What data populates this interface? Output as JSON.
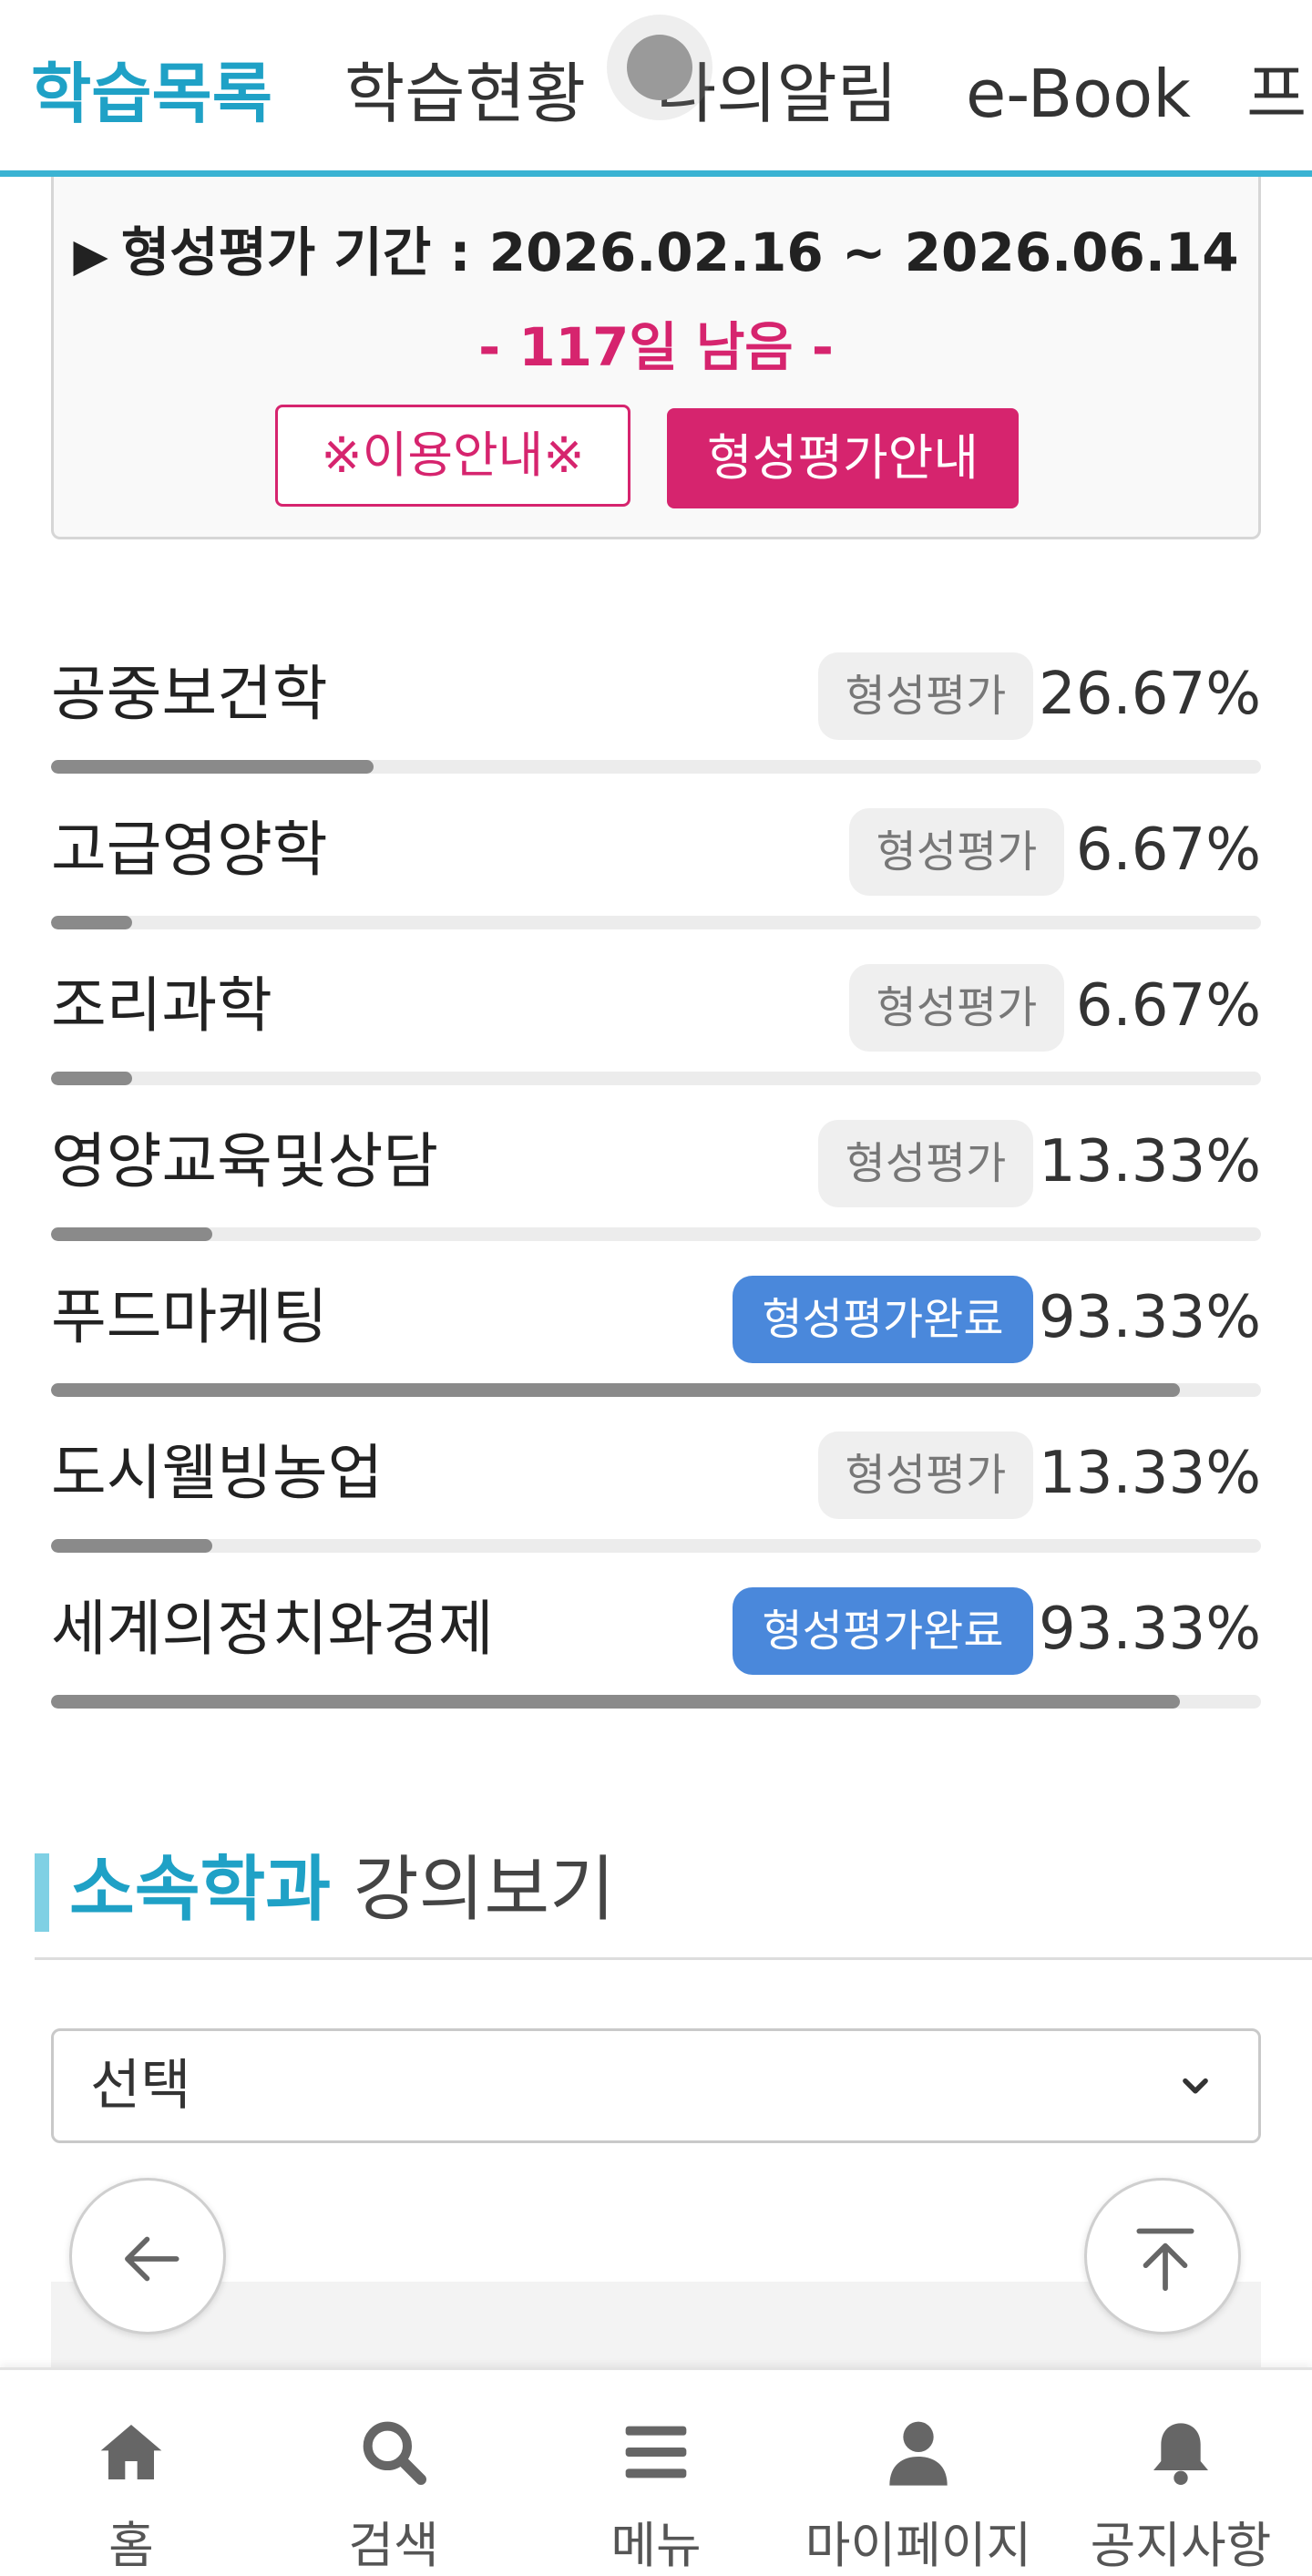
{
  "top_tabs": [
    {
      "label": "학습목록",
      "active": true
    },
    {
      "label": "학습현황",
      "active": false
    },
    {
      "label": "나의알림",
      "active": false
    },
    {
      "label": "e-Book",
      "active": false
    },
    {
      "label": "프",
      "active": false
    }
  ],
  "evaluation": {
    "period_label": "형성평가 기간 : 2026.02.16 ~ 2026.06.14",
    "remaining": "- 117일 남음 -",
    "usage_guide_button": "※이용안내※",
    "evaluation_guide_button": "형성평가안내"
  },
  "courses": [
    {
      "name": "공중보건학",
      "badge": "형성평가",
      "completed": false,
      "percent_text": "26.67%",
      "progress": 0.2667
    },
    {
      "name": "고급영양학",
      "badge": "형성평가",
      "completed": false,
      "percent_text": "6.67%",
      "progress": 0.0667
    },
    {
      "name": "조리과학",
      "badge": "형성평가",
      "completed": false,
      "percent_text": "6.67%",
      "progress": 0.0667
    },
    {
      "name": "영양교육및상담",
      "badge": "형성평가",
      "completed": false,
      "percent_text": "13.33%",
      "progress": 0.1333
    },
    {
      "name": "푸드마케팅",
      "badge": "형성평가완료",
      "completed": true,
      "percent_text": "93.33%",
      "progress": 0.9333
    },
    {
      "name": "도시웰빙농업",
      "badge": "형성평가",
      "completed": false,
      "percent_text": "13.33%",
      "progress": 0.1333
    },
    {
      "name": "세계의정치와경제",
      "badge": "형성평가완료",
      "completed": true,
      "percent_text": "93.33%",
      "progress": 0.9333
    }
  ],
  "department_section": {
    "title_accent": "소속학과",
    "title_rest": " 강의보기",
    "select_value": "선택"
  },
  "floating_buttons": {
    "back_icon": "arrow-left-icon",
    "top_icon": "arrow-up-to-top-icon"
  },
  "bottom_nav": [
    {
      "label": "홈",
      "icon": "home-icon"
    },
    {
      "label": "검색",
      "icon": "search-icon"
    },
    {
      "label": "메뉴",
      "icon": "menu-icon"
    },
    {
      "label": "마이페이지",
      "icon": "user-icon"
    },
    {
      "label": "공지사항",
      "icon": "bell-icon"
    }
  ],
  "colors": {
    "accent_blue": "#1fa1c6",
    "accent_pink": "#d6246e",
    "badge_done_blue": "#4a88db",
    "progress_gray": "#8a8a8a"
  }
}
